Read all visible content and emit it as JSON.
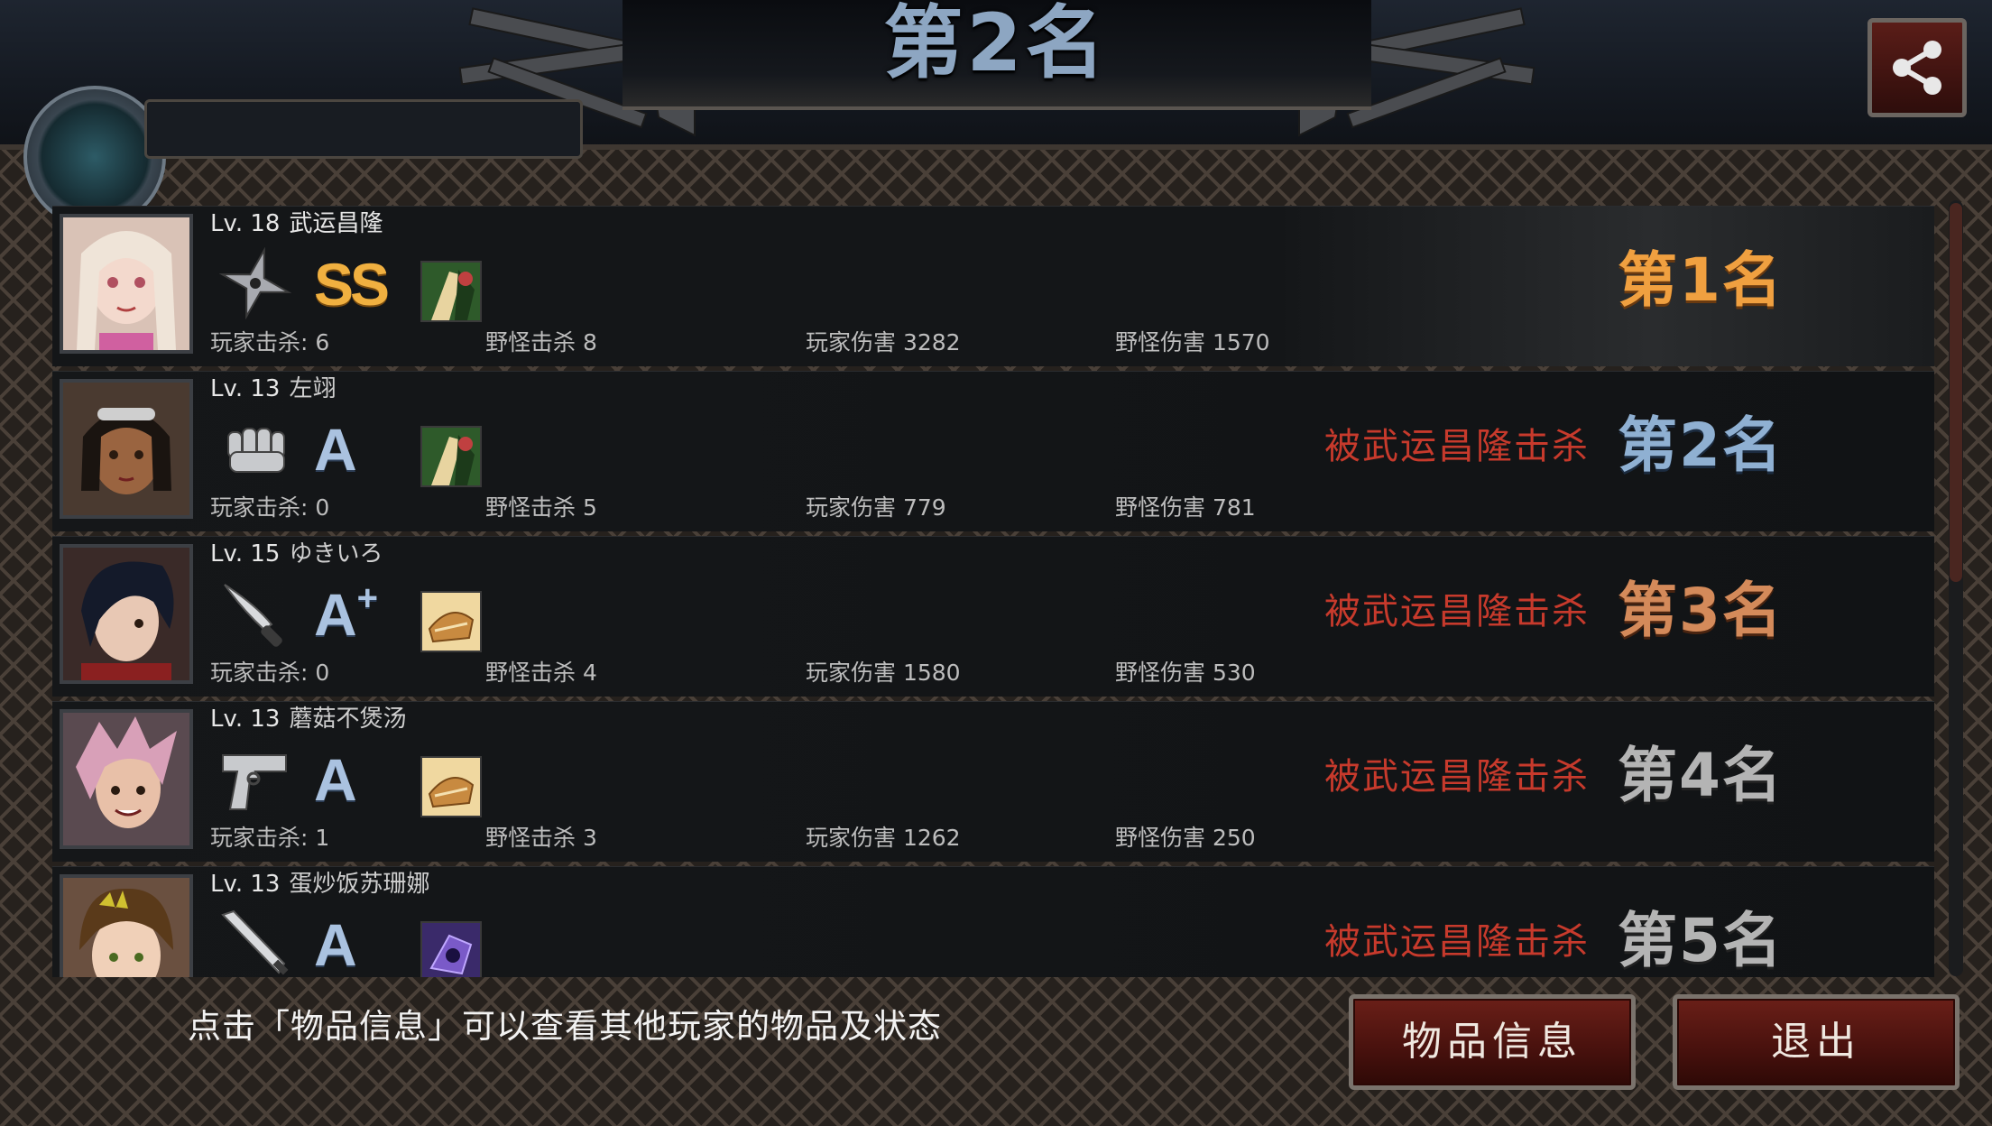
{
  "header": {
    "title": "第2名",
    "share_icon": "share-icon"
  },
  "colors": {
    "killed_text": "#c73a2c",
    "rank_first": "#f0a040",
    "rank_second": "#8fb0d2",
    "rank_third": "#d48a5a",
    "rank_other": "#b4b4b4",
    "button_bg": "#5a1812"
  },
  "results": [
    {
      "level": "Lv. 18",
      "name": "武运昌隆",
      "weapon_icon": "shuriken-icon",
      "grade": "SS",
      "grade_plus": "",
      "item_icon": "character-card-icon",
      "stats": {
        "player_kills": "玩家击杀: 6",
        "monster_kills": "野怪击杀 8",
        "player_damage": "玩家伤害 3282",
        "monster_damage": "野怪伤害 1570"
      },
      "killed_by": "",
      "rank": "第1名"
    },
    {
      "level": "Lv. 13",
      "name": "左翊",
      "weapon_icon": "fist-icon",
      "grade": "A",
      "grade_plus": "",
      "item_icon": "character-card-icon",
      "stats": {
        "player_kills": "玩家击杀: 0",
        "monster_kills": "野怪击杀 5",
        "player_damage": "玩家伤害 779",
        "monster_damage": "野怪伤害 781"
      },
      "killed_by": "被武运昌隆击杀",
      "rank": "第2名"
    },
    {
      "level": "Lv. 15",
      "name": "ゆきいろ",
      "weapon_icon": "knife-icon",
      "grade": "A",
      "grade_plus": "+",
      "item_icon": "bread-icon",
      "stats": {
        "player_kills": "玩家击杀: 0",
        "monster_kills": "野怪击杀 4",
        "player_damage": "玩家伤害 1580",
        "monster_damage": "野怪伤害 530"
      },
      "killed_by": "被武运昌隆击杀",
      "rank": "第3名"
    },
    {
      "level": "Lv. 13",
      "name": "蘑菇不煲汤",
      "weapon_icon": "pistol-icon",
      "grade": "A",
      "grade_plus": "",
      "item_icon": "bread-icon",
      "stats": {
        "player_kills": "玩家击杀: 1",
        "monster_kills": "野怪击杀 3",
        "player_damage": "玩家伤害 1262",
        "monster_damage": "野怪伤害 250"
      },
      "killed_by": "被武运昌隆击杀",
      "rank": "第4名"
    },
    {
      "level": "Lv. 13",
      "name": "蛋炒饭苏珊娜",
      "weapon_icon": "bat-icon",
      "grade": "A",
      "grade_plus": "",
      "item_icon": "gear-crystal-icon",
      "stats": {
        "player_kills": "",
        "monster_kills": "",
        "player_damage": "",
        "monster_damage": ""
      },
      "killed_by": "被武运昌隆击杀",
      "rank": "第5名"
    }
  ],
  "footer": {
    "hint": "点击「物品信息」可以查看其他玩家的物品及状态",
    "item_info_label": "物品信息",
    "exit_label": "退出"
  }
}
